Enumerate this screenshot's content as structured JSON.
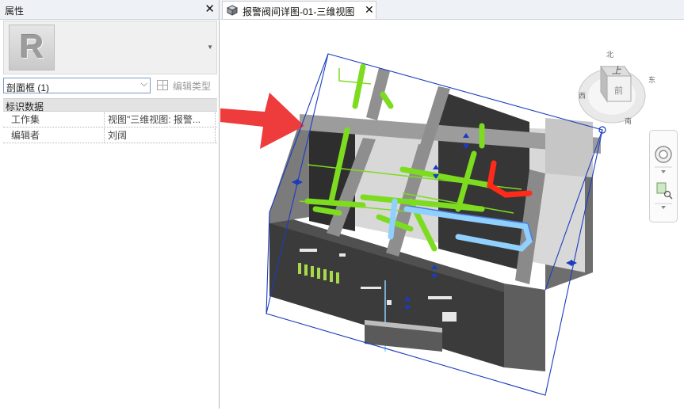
{
  "properties": {
    "title": "属性",
    "close_glyph": "✕",
    "type_logo_letter": "R",
    "instance": "剖面框 (1)",
    "edit_type_label": "编辑类型",
    "section": "标识数据",
    "rows": [
      {
        "key": "工作集",
        "value": "视图\"三维视图: 报警..."
      },
      {
        "key": "编辑者",
        "value": "刘阔"
      }
    ]
  },
  "view": {
    "tab_title": "报警阀间详图-01-三维视图",
    "tab_close": "✕",
    "viewcube": {
      "face_top": "上",
      "face_side": "前",
      "compass": [
        "北",
        "东",
        "南",
        "西"
      ]
    }
  },
  "colors": {
    "pipe_green": "#7ddc1f",
    "pipe_blue": "#8fd0ff",
    "pipe_red": "#ff2a1a",
    "section_box": "#1a3cc0",
    "annotation_arrow": "#ee3b3b",
    "panel_header": "#eef1f5"
  }
}
